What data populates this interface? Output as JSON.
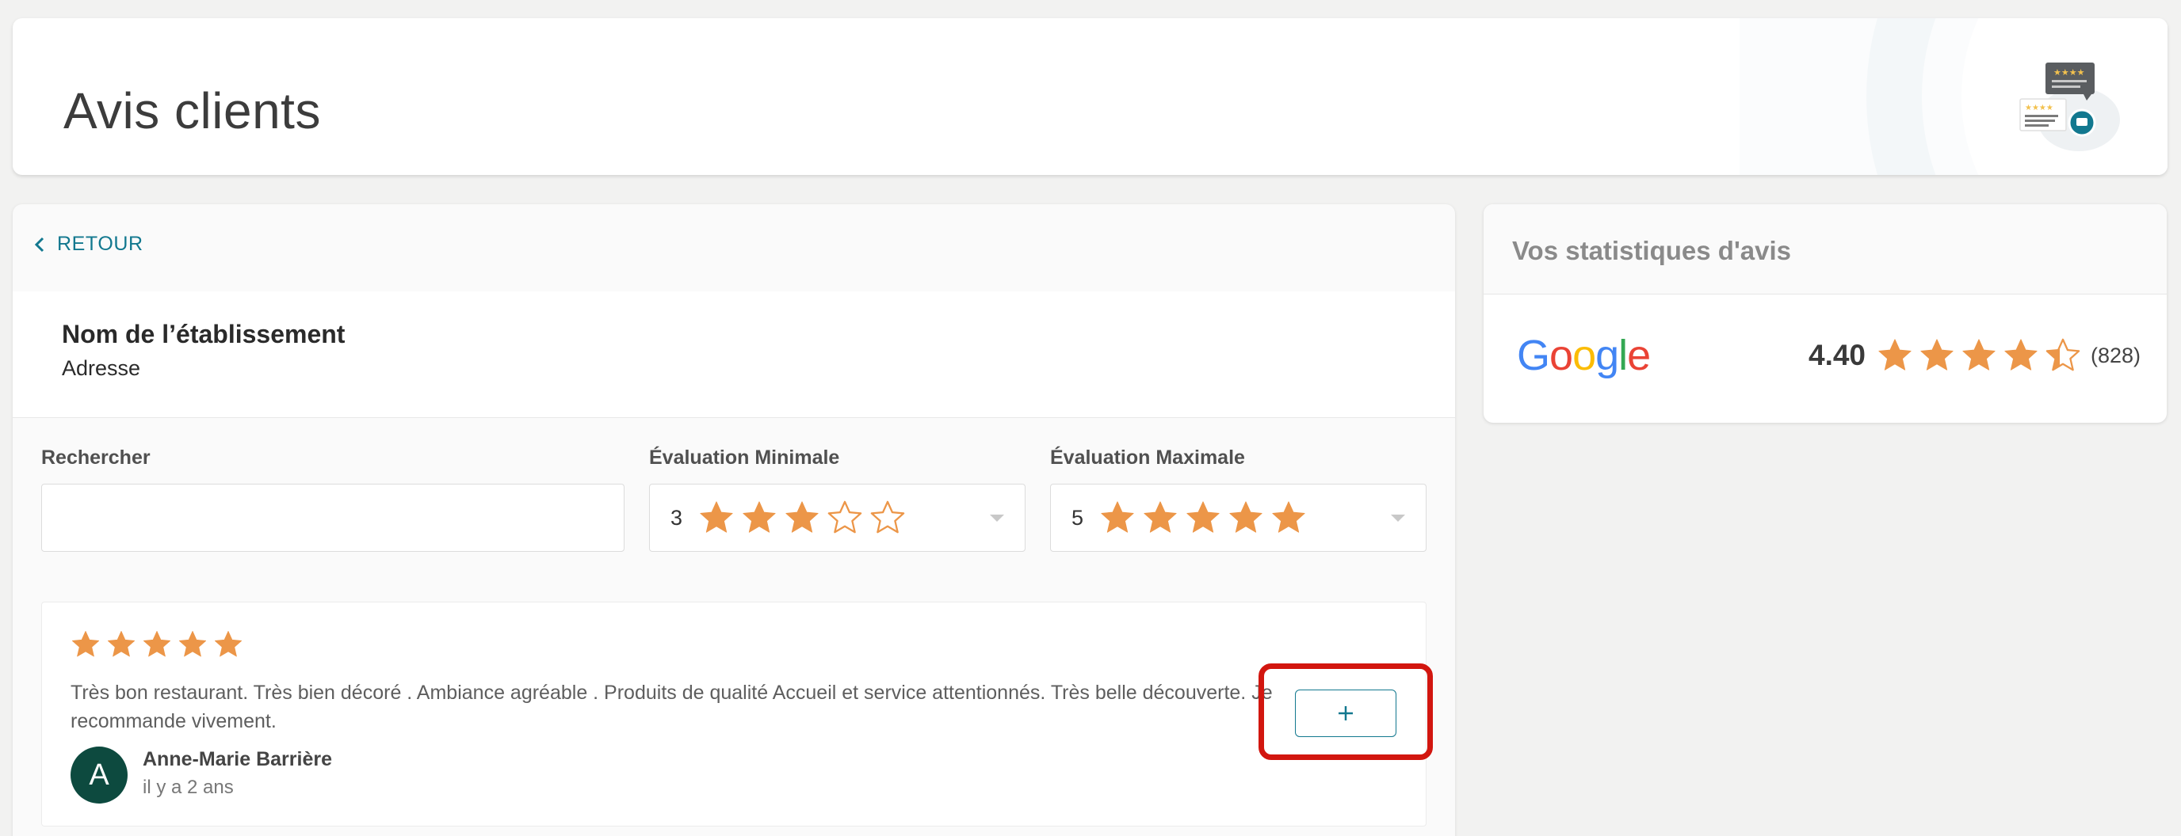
{
  "header": {
    "title": "Avis clients",
    "illustration_icon": "reviews-illustration-icon"
  },
  "nav": {
    "back_label": "RETOUR"
  },
  "establishment": {
    "name": "Nom de l’établissement",
    "address": "Adresse"
  },
  "filters": {
    "search_label": "Rechercher",
    "search_value": "",
    "min_label": "Évaluation Minimale",
    "min_value": "3",
    "min_stars": 3,
    "max_label": "Évaluation Maximale",
    "max_value": "5",
    "max_stars": 5
  },
  "review": {
    "stars": 5,
    "text": "Très bon restaurant. Très bien décoré . Ambiance agréable . Produits de qualité Accueil et service attentionnés. Très belle découverte. Je recommande vivement.",
    "author": "Anne-Marie Barrière",
    "avatar_letter": "A",
    "time": "il y a 2 ans",
    "expand_icon": "plus-icon"
  },
  "stats": {
    "title": "Vos statistiques d'avis",
    "provider": "Google",
    "score": "4.40",
    "stars_value": 4.4,
    "count": "(828)"
  },
  "colors": {
    "accent": "#12788f",
    "star": "#ec9648",
    "highlight": "#d2160f",
    "avatar": "#0d4a3f",
    "google_blue": "#4285f4",
    "google_red": "#ea4335",
    "google_yellow": "#fbbc05",
    "google_green": "#34a853"
  }
}
